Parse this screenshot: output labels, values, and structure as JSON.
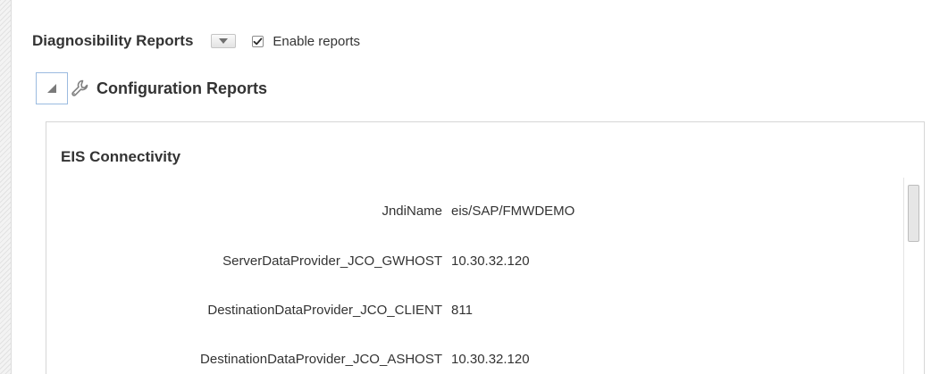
{
  "header": {
    "title": "Diagnosibility Reports",
    "enable_reports": {
      "label": "Enable reports",
      "checked": true
    }
  },
  "config": {
    "title": "Configuration Reports",
    "icon": "wrench-icon",
    "expanded": true
  },
  "panel": {
    "title": "EIS Connectivity",
    "properties": [
      {
        "label": "JndiName",
        "value": "eis/SAP/FMWDEMO"
      },
      {
        "label": "ServerDataProvider_JCO_GWHOST",
        "value": "10.30.32.120"
      },
      {
        "label": "DestinationDataProvider_JCO_CLIENT",
        "value": "811"
      },
      {
        "label": "DestinationDataProvider_JCO_ASHOST",
        "value": "10.30.32.120"
      }
    ]
  },
  "colors": {
    "text": "#333333",
    "focus_border": "#9bbbe0",
    "panel_border": "#d6d6d6"
  }
}
